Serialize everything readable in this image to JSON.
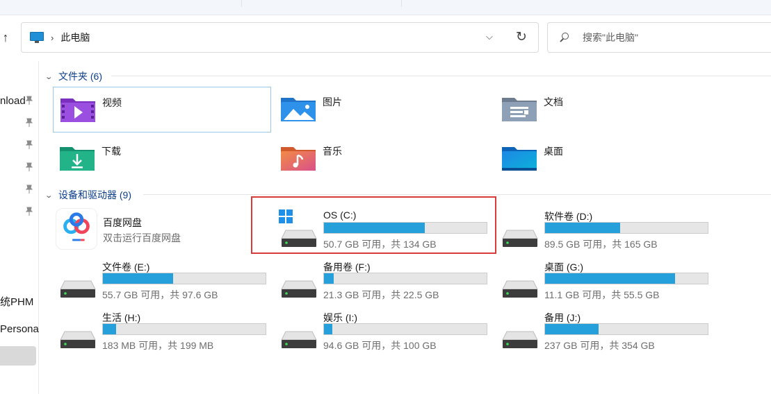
{
  "nav": {
    "back_arrow_icon": "up-arrow-icon",
    "items": [
      {
        "label": "nload",
        "pinned": true
      },
      {
        "label": "",
        "pinned": true
      },
      {
        "label": "",
        "pinned": true
      },
      {
        "label": "",
        "pinned": true
      },
      {
        "label": "",
        "pinned": true
      },
      {
        "label": "",
        "pinned": true
      },
      {
        "label": "统PHM",
        "pinned": false
      },
      {
        "label": "Persona",
        "pinned": false
      }
    ]
  },
  "address": {
    "icon": "this-pc-icon",
    "crumb": "此电脑"
  },
  "search": {
    "placeholder": "搜索\"此电脑\""
  },
  "folders_section": {
    "title": "文件夹 (6)",
    "items": [
      {
        "label": "视频",
        "icon": "videos-folder-icon"
      },
      {
        "label": "图片",
        "icon": "pictures-folder-icon"
      },
      {
        "label": "文档",
        "icon": "documents-folder-icon"
      },
      {
        "label": "下载",
        "icon": "downloads-folder-icon"
      },
      {
        "label": "音乐",
        "icon": "music-folder-icon"
      },
      {
        "label": "桌面",
        "icon": "desktop-folder-icon"
      }
    ]
  },
  "devices_section": {
    "title": "设备和驱动器 (9)",
    "app": {
      "name": "百度网盘",
      "desc": "双击运行百度网盘",
      "icon": "baidu-netdisk-icon"
    },
    "drives": [
      {
        "name": "OS (C:)",
        "info": "50.7 GB 可用，共 134 GB",
        "used_fraction": 0.62,
        "system": true
      },
      {
        "name": "软件卷 (D:)",
        "info": "89.5 GB 可用，共 165 GB",
        "used_fraction": 0.46,
        "system": false
      },
      {
        "name": "文件卷 (E:)",
        "info": "55.7 GB 可用，共 97.6 GB",
        "used_fraction": 0.43,
        "system": false
      },
      {
        "name": "备用卷 (F:)",
        "info": "21.3 GB 可用，共 22.5 GB",
        "used_fraction": 0.06,
        "system": false
      },
      {
        "name": "桌面 (G:)",
        "info": "11.1 GB 可用，共 55.5 GB",
        "used_fraction": 0.8,
        "system": false
      },
      {
        "name": "生活 (H:)",
        "info": "183 MB 可用，共 199 MB",
        "used_fraction": 0.08,
        "system": false
      },
      {
        "name": "娱乐 (I:)",
        "info": "94.6 GB 可用，共 100 GB",
        "used_fraction": 0.05,
        "system": false
      },
      {
        "name": "备用 (J:)",
        "info": "237 GB 可用，共 354 GB",
        "used_fraction": 0.33,
        "system": false
      }
    ]
  },
  "colors": {
    "bar_fill": "#26a0da",
    "highlight_box": "#d93a3a",
    "section_title": "#0b3e8a"
  }
}
